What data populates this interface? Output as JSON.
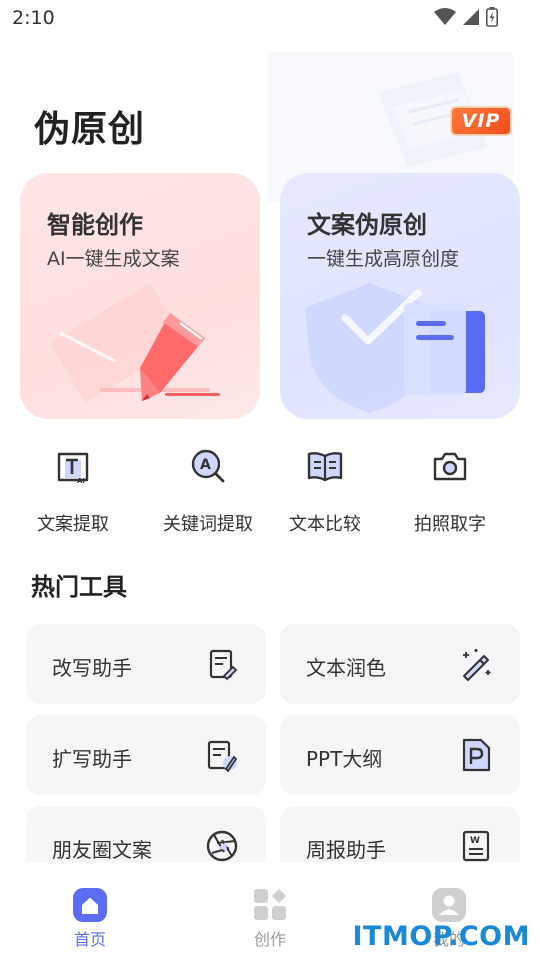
{
  "status_bar": {
    "time": "2:10"
  },
  "header": {
    "title": "伪原创",
    "vip_label": "VIP"
  },
  "feature_cards": [
    {
      "title": "智能创作",
      "subtitle": "AI一键生成文案"
    },
    {
      "title": "文案伪原创",
      "subtitle": "一键生成高原创度"
    }
  ],
  "quick_actions": [
    {
      "label": "文案提取",
      "icon": "text-ai-icon"
    },
    {
      "label": "关键词提取",
      "icon": "keyword-search-icon"
    },
    {
      "label": "文本比较",
      "icon": "open-book-icon"
    },
    {
      "label": "拍照取字",
      "icon": "camera-icon"
    }
  ],
  "hot_tools": {
    "title": "热门工具",
    "items": [
      {
        "label": "改写助手",
        "icon": "doc-edit-icon"
      },
      {
        "label": "文本润色",
        "icon": "magic-wand-icon"
      },
      {
        "label": "扩写助手",
        "icon": "doc-pen-icon"
      },
      {
        "label": "PPT大纲",
        "icon": "ppt-file-icon"
      },
      {
        "label": "朋友圈文案",
        "icon": "aperture-icon"
      },
      {
        "label": "周报助手",
        "icon": "word-doc-icon"
      }
    ]
  },
  "tab_bar": {
    "tabs": [
      {
        "label": "首页",
        "icon": "home-icon",
        "active": true
      },
      {
        "label": "创作",
        "icon": "grid-icon",
        "active": false
      },
      {
        "label": "我的",
        "icon": "user-icon",
        "active": false
      }
    ]
  },
  "watermark": "ITMOP.COM",
  "colors": {
    "accent": "#5b6cf5",
    "vip": "#f24d1e",
    "watermark": "#1a8ad8"
  }
}
